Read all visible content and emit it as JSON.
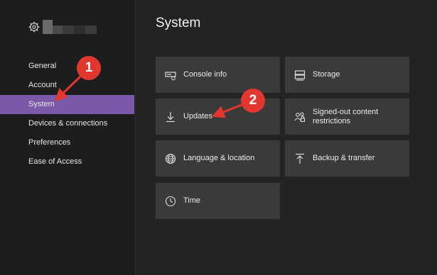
{
  "sidebar": {
    "items": [
      {
        "label": "General"
      },
      {
        "label": "Account"
      },
      {
        "label": "System"
      },
      {
        "label": "Devices & connections"
      },
      {
        "label": "Preferences"
      },
      {
        "label": "Ease of Access"
      }
    ],
    "selected": "System"
  },
  "main": {
    "title": "System",
    "tiles": [
      {
        "label": "Console info",
        "icon": "console-info-icon"
      },
      {
        "label": "Storage",
        "icon": "storage-icon"
      },
      {
        "label": "Updates",
        "icon": "download-icon"
      },
      {
        "label_line1": "Signed-out content",
        "label_line2": "restrictions",
        "icon": "people-lock-icon"
      },
      {
        "label": "Language & location",
        "icon": "globe-icon"
      },
      {
        "label": "Backup & transfer",
        "icon": "upload-icon"
      },
      {
        "label": "Time",
        "icon": "clock-icon"
      }
    ]
  },
  "annotations": [
    {
      "label": "1"
    },
    {
      "label": "2"
    }
  ],
  "colors": {
    "selected": "#7a5aa8",
    "tile": "#3a3a3a",
    "background": "#232323",
    "annotation": "#e2372e"
  }
}
